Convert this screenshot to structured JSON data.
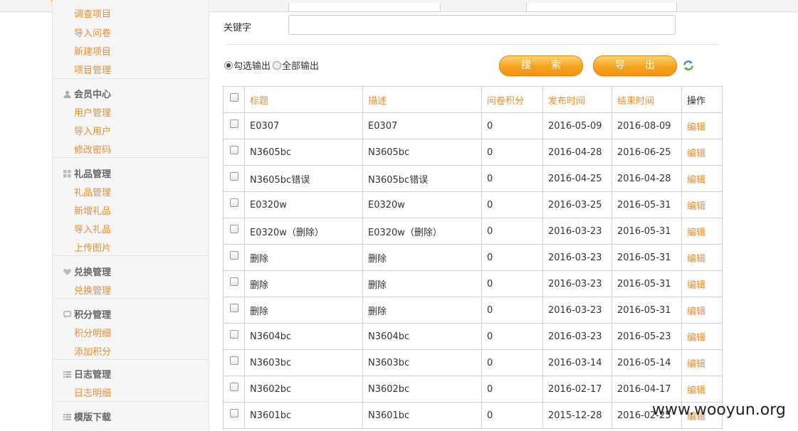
{
  "sidebar": {
    "top_links": [
      "调查项目",
      "导入问卷",
      "新建项目",
      "项目管理"
    ],
    "sections": [
      {
        "title": "会员中心",
        "icon": "user-icon",
        "links": [
          "用户管理",
          "导入用户",
          "修改密码"
        ]
      },
      {
        "title": "礼品管理",
        "icon": "grid-icon",
        "links": [
          "礼品管理",
          "新增礼品",
          "导入礼品",
          "上传图片"
        ]
      },
      {
        "title": "兑换管理",
        "icon": "heart-icon",
        "links": [
          "兑换管理"
        ]
      },
      {
        "title": "积分管理",
        "icon": "chat-icon",
        "links": [
          "积分明细",
          "添加积分"
        ]
      },
      {
        "title": "日志管理",
        "icon": "list-icon",
        "links": [
          "日志明细"
        ]
      },
      {
        "title": "模版下载",
        "icon": "list-icon",
        "links": []
      }
    ]
  },
  "search": {
    "keyword_label": "关键字",
    "keyword_value": "",
    "radio_selected": "勾选输出",
    "radio_all": "全部输出",
    "search_button": "搜索",
    "export_button": "导出"
  },
  "table": {
    "headers": [
      "标题",
      "描述",
      "问卷积分",
      "发布时间",
      "结束时间",
      "操作"
    ],
    "rows": [
      {
        "title": "E0307",
        "desc": "E0307",
        "points": "0",
        "publish": "2016-05-09",
        "end": "2016-08-09",
        "action": "编辑"
      },
      {
        "title": "N3605bc",
        "desc": "N3605bc",
        "points": "0",
        "publish": "2016-04-28",
        "end": "2016-06-25",
        "action": "编辑"
      },
      {
        "title": "N3605bc错误",
        "desc": "N3605bc错误",
        "points": "0",
        "publish": "2016-04-25",
        "end": "2016-04-28",
        "action": "编辑"
      },
      {
        "title": "E0320w",
        "desc": "E0320w",
        "points": "0",
        "publish": "2016-03-25",
        "end": "2016-05-31",
        "action": "编辑"
      },
      {
        "title": "E0320w（删除）",
        "desc": "E0320w（删除）",
        "points": "0",
        "publish": "2016-03-23",
        "end": "2016-05-31",
        "action": "编辑"
      },
      {
        "title": "删除",
        "desc": "删除",
        "points": "0",
        "publish": "2016-03-23",
        "end": "2016-05-31",
        "action": "编辑"
      },
      {
        "title": "删除",
        "desc": "删除",
        "points": "0",
        "publish": "2016-03-23",
        "end": "2016-05-31",
        "action": "编辑"
      },
      {
        "title": "删除",
        "desc": "删除",
        "points": "0",
        "publish": "2016-03-23",
        "end": "2016-05-31",
        "action": "编辑"
      },
      {
        "title": "N3604bc",
        "desc": "N3604bc",
        "points": "0",
        "publish": "2016-03-23",
        "end": "2016-05-23",
        "action": "编辑"
      },
      {
        "title": "N3603bc",
        "desc": "N3603bc",
        "points": "0",
        "publish": "2016-03-14",
        "end": "2016-05-14",
        "action": "编辑"
      },
      {
        "title": "N3602bc",
        "desc": "N3602bc",
        "points": "0",
        "publish": "2016-02-17",
        "end": "2016-04-17",
        "action": "编辑"
      },
      {
        "title": "N3601bc",
        "desc": "N3601bc",
        "points": "0",
        "publish": "2015-12-28",
        "end": "2016-02-25",
        "action": "编辑"
      }
    ]
  },
  "watermark": "www.wooyun.org",
  "colors": {
    "accent": "#f08c2a",
    "sidebar_bg": "#f6f6f6",
    "border": "#cfcfcf"
  }
}
